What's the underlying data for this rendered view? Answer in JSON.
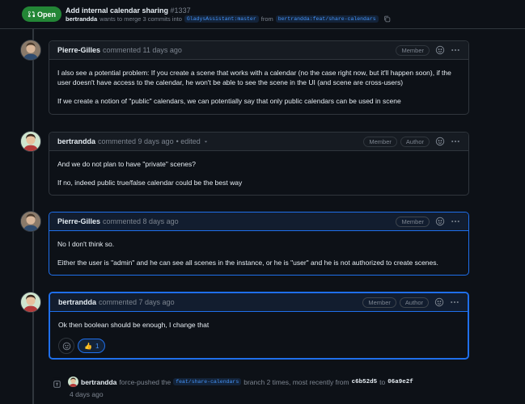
{
  "header": {
    "state": "Open",
    "title": "Add internal calendar sharing",
    "number": "#1337",
    "author": "bertrandda",
    "merge_text": "wants to merge 3 commits into",
    "base_branch": "GladysAssistant:master",
    "from_text": "from",
    "head_branch": "bertrandda:feat/share-calendars"
  },
  "comments": [
    {
      "author": "Pierre-Gilles",
      "action": "commented 11 days ago",
      "role": "Member",
      "body": [
        "I also see a potential problem: If you create a scene that works with a calendar (no the case right now, but it'll happen soon), if the user doesn't have access to the calendar, he won't be able to see the scene in the UI (and scene are cross-users)",
        "If we create a notion of \"public\" calendars, we can potentially say that only public calendars can be used in scene"
      ]
    },
    {
      "author": "bertrandda",
      "action": "commented 9 days ago",
      "edited": "• edited",
      "role": "Member",
      "role2": "Author",
      "body": [
        "And we do not plan to have \"private\" scenes?",
        "If no, indeed public true/false calendar could be the best way"
      ]
    },
    {
      "author": "Pierre-Gilles",
      "action": "commented 8 days ago",
      "role": "Member",
      "body": [
        "No I don't think so.",
        "Either the user is \"admin\" and he can see all scenes in the instance, or he is \"user\" and he is not authorized to create scenes."
      ]
    },
    {
      "author": "bertrandda",
      "action": "commented 7 days ago",
      "role": "Member",
      "role2": "Author",
      "body": [
        "Ok then boolean should be enough, I change that"
      ],
      "reaction_emoji": "👍",
      "reaction_count": "1"
    }
  ],
  "event": {
    "author": "bertrandda",
    "action": "force-pushed the",
    "branch": "feat/share-calendars",
    "suffix": "branch 2 times, most recently from",
    "from_sha": "c6b52d5",
    "to_text": "to",
    "to_sha": "06a9e2f",
    "time": "4 days ago"
  },
  "colors": {
    "open_green": "#238636",
    "accent_blue": "#1f6feb",
    "bg": "#0d1117"
  }
}
